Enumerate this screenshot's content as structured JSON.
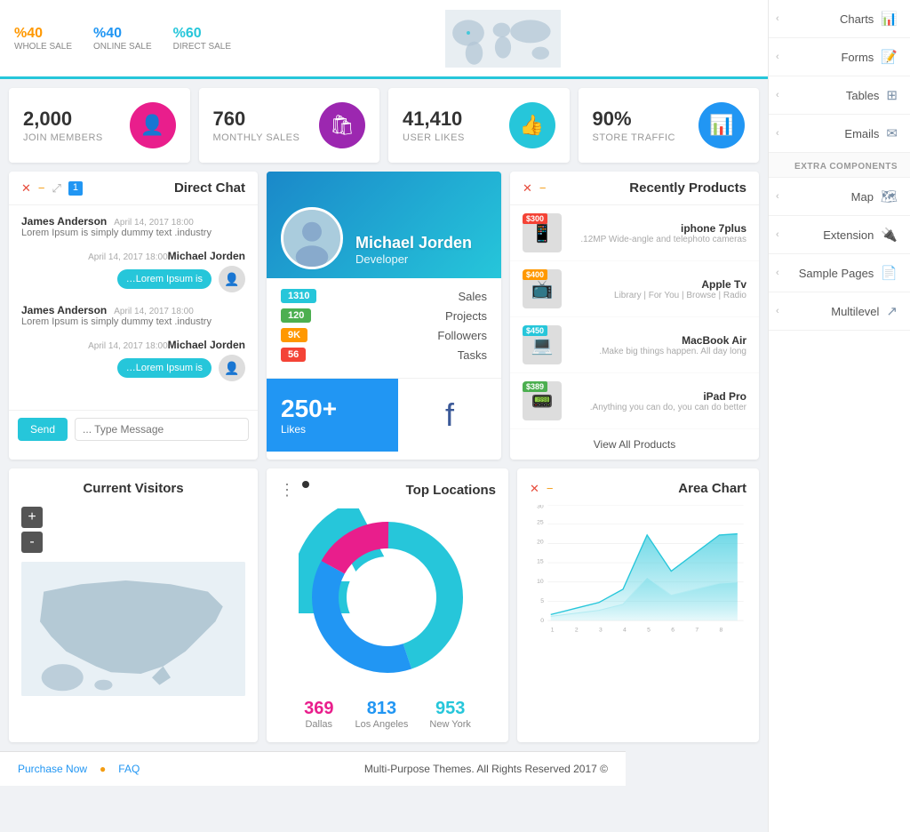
{
  "topStats": {
    "wholeSale": {
      "pct": "%40",
      "label": "WHOLE SALE"
    },
    "onlineSale": {
      "pct": "%40",
      "label": "ONLINE SALE"
    },
    "directSale": {
      "pct": "%60",
      "label": "DIRECT SALE"
    }
  },
  "metrics": [
    {
      "value": "2,000",
      "name": "JOIN MEMBERS",
      "iconColor": "bg-pink",
      "icon": "👤"
    },
    {
      "value": "760",
      "name": "MONTHLY SALES",
      "iconColor": "bg-purple",
      "icon": "🛍"
    },
    {
      "value": "41,410",
      "name": "USER LIKES",
      "iconColor": "bg-teal",
      "icon": "👍"
    },
    {
      "value": "90%",
      "name": "STORE TRAFFIC",
      "iconColor": "bg-blue",
      "icon": "📊"
    }
  ],
  "chat": {
    "title": "Direct Chat",
    "messages": [
      {
        "side": "left",
        "sender": "James Anderson",
        "time": "April 14, 2017 18:00",
        "text": "Lorem Ipsum is simply dummy text .industry",
        "hasAvatar": false
      },
      {
        "side": "right",
        "sender": "Michael Jorden",
        "time": "April 14, 2017 18:00",
        "text": "…Lorem Ipsum is",
        "hasAvatar": true
      },
      {
        "side": "left",
        "sender": "James Anderson",
        "time": "April 14, 2017 18:00",
        "text": "Lorem Ipsum is simply dummy text .industry",
        "hasAvatar": false
      },
      {
        "side": "right",
        "sender": "Michael Jorden",
        "time": "April 14, 2017 18:00",
        "text": "…Lorem Ipsum is",
        "hasAvatar": true
      }
    ],
    "sendBtn": "Send",
    "inputPlaceholder": "... Type Message"
  },
  "profile": {
    "name": "Michael Jorden",
    "role": "Developer",
    "stats": [
      {
        "label": "Sales",
        "value": "1310",
        "badgeColor": "badge-teal"
      },
      {
        "label": "Projects",
        "value": "120",
        "badgeColor": "badge-green"
      },
      {
        "label": "Followers",
        "value": "9K",
        "badgeColor": "badge-orange"
      },
      {
        "label": "Tasks",
        "value": "56",
        "badgeColor": "badge-red"
      }
    ],
    "likes": "250+",
    "likesLabel": "Likes"
  },
  "products": {
    "title": "Recently Products",
    "items": [
      {
        "name": "iphone 7plus",
        "desc": ".12MP Wide-angle and telephoto cameras",
        "price": "$300",
        "priceColor": "price-red",
        "emoji": "📱"
      },
      {
        "name": "Apple Tv",
        "desc": "Library | For You | Browse | Radio",
        "price": "$400",
        "priceColor": "price-orange",
        "emoji": "📺"
      },
      {
        "name": "MacBook Air",
        "desc": ".Make big things happen. All day long",
        "price": "$450",
        "priceColor": "price-teal",
        "emoji": "💻"
      },
      {
        "name": "iPad Pro",
        "desc": ".Anything you can do, you can do better",
        "price": "$389",
        "priceColor": "price-green",
        "emoji": "📟"
      }
    ],
    "viewAll": "View All Products"
  },
  "mapCard": {
    "title": "Current Visitors",
    "zoomIn": "+",
    "zoomOut": "-"
  },
  "donut": {
    "title": "Top Locations",
    "legend": [
      {
        "value": "369",
        "label": "Dallas",
        "colorClass": "color-pink"
      },
      {
        "value": "813",
        "label": "Los Angeles",
        "colorClass": "color-blue"
      },
      {
        "value": "953",
        "label": "New York",
        "colorClass": "color-teal"
      }
    ]
  },
  "areaChart": {
    "title": "Area Chart",
    "xLabels": [
      "1",
      "2",
      "3",
      "4",
      "5",
      "6",
      "7",
      "8"
    ],
    "yLabels": [
      "0",
      "5",
      "10",
      "15",
      "20",
      "25",
      "30"
    ]
  },
  "sidebar": {
    "mainItems": [
      {
        "label": "Charts",
        "icon": "📊"
      },
      {
        "label": "Forms",
        "icon": "📝"
      },
      {
        "label": "Tables",
        "icon": "⊞"
      },
      {
        "label": "Emails",
        "icon": "✉"
      }
    ],
    "extraTitle": "EXTRA COMPONENTS",
    "extraItems": [
      {
        "label": "Map",
        "icon": "🗺"
      },
      {
        "label": "Extension",
        "icon": "🔌"
      },
      {
        "label": "Sample Pages",
        "icon": "📄"
      },
      {
        "label": "Multilevel",
        "icon": "↗"
      }
    ]
  },
  "footer": {
    "purchase": "Purchase Now",
    "faq": "FAQ",
    "copyright": "Multi-Purpose Themes. All Rights Reserved 2017 ©"
  }
}
